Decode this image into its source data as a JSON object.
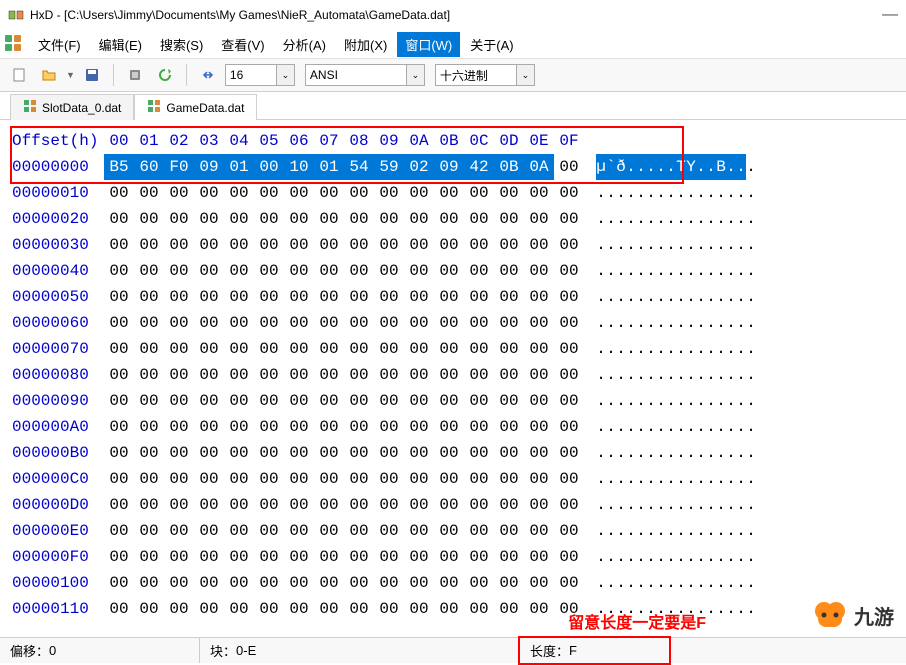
{
  "title": "HxD - [C:\\Users\\Jimmy\\Documents\\My Games\\NieR_Automata\\GameData.dat]",
  "menu": {
    "file": "文件(F)",
    "edit": "编辑(E)",
    "search": "搜索(S)",
    "view": "查看(V)",
    "analysis": "分析(A)",
    "extras": "附加(X)",
    "window": "窗口(W)",
    "about": "关于(A)"
  },
  "toolbar": {
    "bytes_per_row": "16",
    "encoding": "ANSI",
    "base": "十六进制"
  },
  "tabs": {
    "tab1": "SlotData_0.dat",
    "tab2": "GameData.dat"
  },
  "hex": {
    "offset_label": "Offset(h)",
    "cols": [
      "00",
      "01",
      "02",
      "03",
      "04",
      "05",
      "06",
      "07",
      "08",
      "09",
      "0A",
      "0B",
      "0C",
      "0D",
      "0E",
      "0F"
    ],
    "rows": [
      {
        "off": "00000000",
        "b": [
          "B5",
          "60",
          "F0",
          "09",
          "01",
          "00",
          "10",
          "01",
          "54",
          "59",
          "02",
          "09",
          "42",
          "0B",
          "0A",
          "00"
        ],
        "a": [
          "µ",
          "`",
          "ð",
          ".",
          ".",
          ".",
          ".",
          ".",
          "T",
          "Y",
          ".",
          ".",
          "B",
          ".",
          ".",
          "."
        ],
        "sel": 15
      },
      {
        "off": "00000010",
        "b": [
          "00",
          "00",
          "00",
          "00",
          "00",
          "00",
          "00",
          "00",
          "00",
          "00",
          "00",
          "00",
          "00",
          "00",
          "00",
          "00"
        ],
        "a": [
          ".",
          ".",
          ".",
          ".",
          ".",
          ".",
          ".",
          ".",
          ".",
          ".",
          ".",
          ".",
          ".",
          ".",
          ".",
          "."
        ]
      },
      {
        "off": "00000020",
        "b": [
          "00",
          "00",
          "00",
          "00",
          "00",
          "00",
          "00",
          "00",
          "00",
          "00",
          "00",
          "00",
          "00",
          "00",
          "00",
          "00"
        ],
        "a": [
          ".",
          ".",
          ".",
          ".",
          ".",
          ".",
          ".",
          ".",
          ".",
          ".",
          ".",
          ".",
          ".",
          ".",
          ".",
          "."
        ]
      },
      {
        "off": "00000030",
        "b": [
          "00",
          "00",
          "00",
          "00",
          "00",
          "00",
          "00",
          "00",
          "00",
          "00",
          "00",
          "00",
          "00",
          "00",
          "00",
          "00"
        ],
        "a": [
          ".",
          ".",
          ".",
          ".",
          ".",
          ".",
          ".",
          ".",
          ".",
          ".",
          ".",
          ".",
          ".",
          ".",
          ".",
          "."
        ]
      },
      {
        "off": "00000040",
        "b": [
          "00",
          "00",
          "00",
          "00",
          "00",
          "00",
          "00",
          "00",
          "00",
          "00",
          "00",
          "00",
          "00",
          "00",
          "00",
          "00"
        ],
        "a": [
          ".",
          ".",
          ".",
          ".",
          ".",
          ".",
          ".",
          ".",
          ".",
          ".",
          ".",
          ".",
          ".",
          ".",
          ".",
          "."
        ]
      },
      {
        "off": "00000050",
        "b": [
          "00",
          "00",
          "00",
          "00",
          "00",
          "00",
          "00",
          "00",
          "00",
          "00",
          "00",
          "00",
          "00",
          "00",
          "00",
          "00"
        ],
        "a": [
          ".",
          ".",
          ".",
          ".",
          ".",
          ".",
          ".",
          ".",
          ".",
          ".",
          ".",
          ".",
          ".",
          ".",
          ".",
          "."
        ]
      },
      {
        "off": "00000060",
        "b": [
          "00",
          "00",
          "00",
          "00",
          "00",
          "00",
          "00",
          "00",
          "00",
          "00",
          "00",
          "00",
          "00",
          "00",
          "00",
          "00"
        ],
        "a": [
          ".",
          ".",
          ".",
          ".",
          ".",
          ".",
          ".",
          ".",
          ".",
          ".",
          ".",
          ".",
          ".",
          ".",
          ".",
          "."
        ]
      },
      {
        "off": "00000070",
        "b": [
          "00",
          "00",
          "00",
          "00",
          "00",
          "00",
          "00",
          "00",
          "00",
          "00",
          "00",
          "00",
          "00",
          "00",
          "00",
          "00"
        ],
        "a": [
          ".",
          ".",
          ".",
          ".",
          ".",
          ".",
          ".",
          ".",
          ".",
          ".",
          ".",
          ".",
          ".",
          ".",
          ".",
          "."
        ]
      },
      {
        "off": "00000080",
        "b": [
          "00",
          "00",
          "00",
          "00",
          "00",
          "00",
          "00",
          "00",
          "00",
          "00",
          "00",
          "00",
          "00",
          "00",
          "00",
          "00"
        ],
        "a": [
          ".",
          ".",
          ".",
          ".",
          ".",
          ".",
          ".",
          ".",
          ".",
          ".",
          ".",
          ".",
          ".",
          ".",
          ".",
          "."
        ]
      },
      {
        "off": "00000090",
        "b": [
          "00",
          "00",
          "00",
          "00",
          "00",
          "00",
          "00",
          "00",
          "00",
          "00",
          "00",
          "00",
          "00",
          "00",
          "00",
          "00"
        ],
        "a": [
          ".",
          ".",
          ".",
          ".",
          ".",
          ".",
          ".",
          ".",
          ".",
          ".",
          ".",
          ".",
          ".",
          ".",
          ".",
          "."
        ]
      },
      {
        "off": "000000A0",
        "b": [
          "00",
          "00",
          "00",
          "00",
          "00",
          "00",
          "00",
          "00",
          "00",
          "00",
          "00",
          "00",
          "00",
          "00",
          "00",
          "00"
        ],
        "a": [
          ".",
          ".",
          ".",
          ".",
          ".",
          ".",
          ".",
          ".",
          ".",
          ".",
          ".",
          ".",
          ".",
          ".",
          ".",
          "."
        ]
      },
      {
        "off": "000000B0",
        "b": [
          "00",
          "00",
          "00",
          "00",
          "00",
          "00",
          "00",
          "00",
          "00",
          "00",
          "00",
          "00",
          "00",
          "00",
          "00",
          "00"
        ],
        "a": [
          ".",
          ".",
          ".",
          ".",
          ".",
          ".",
          ".",
          ".",
          ".",
          ".",
          ".",
          ".",
          ".",
          ".",
          ".",
          "."
        ]
      },
      {
        "off": "000000C0",
        "b": [
          "00",
          "00",
          "00",
          "00",
          "00",
          "00",
          "00",
          "00",
          "00",
          "00",
          "00",
          "00",
          "00",
          "00",
          "00",
          "00"
        ],
        "a": [
          ".",
          ".",
          ".",
          ".",
          ".",
          ".",
          ".",
          ".",
          ".",
          ".",
          ".",
          ".",
          ".",
          ".",
          ".",
          "."
        ]
      },
      {
        "off": "000000D0",
        "b": [
          "00",
          "00",
          "00",
          "00",
          "00",
          "00",
          "00",
          "00",
          "00",
          "00",
          "00",
          "00",
          "00",
          "00",
          "00",
          "00"
        ],
        "a": [
          ".",
          ".",
          ".",
          ".",
          ".",
          ".",
          ".",
          ".",
          ".",
          ".",
          ".",
          ".",
          ".",
          ".",
          ".",
          "."
        ]
      },
      {
        "off": "000000E0",
        "b": [
          "00",
          "00",
          "00",
          "00",
          "00",
          "00",
          "00",
          "00",
          "00",
          "00",
          "00",
          "00",
          "00",
          "00",
          "00",
          "00"
        ],
        "a": [
          ".",
          ".",
          ".",
          ".",
          ".",
          ".",
          ".",
          ".",
          ".",
          ".",
          ".",
          ".",
          ".",
          ".",
          ".",
          "."
        ]
      },
      {
        "off": "000000F0",
        "b": [
          "00",
          "00",
          "00",
          "00",
          "00",
          "00",
          "00",
          "00",
          "00",
          "00",
          "00",
          "00",
          "00",
          "00",
          "00",
          "00"
        ],
        "a": [
          ".",
          ".",
          ".",
          ".",
          ".",
          ".",
          ".",
          ".",
          ".",
          ".",
          ".",
          ".",
          ".",
          ".",
          ".",
          "."
        ]
      },
      {
        "off": "00000100",
        "b": [
          "00",
          "00",
          "00",
          "00",
          "00",
          "00",
          "00",
          "00",
          "00",
          "00",
          "00",
          "00",
          "00",
          "00",
          "00",
          "00"
        ],
        "a": [
          ".",
          ".",
          ".",
          ".",
          ".",
          ".",
          ".",
          ".",
          ".",
          ".",
          ".",
          ".",
          ".",
          ".",
          ".",
          "."
        ]
      },
      {
        "off": "00000110",
        "b": [
          "00",
          "00",
          "00",
          "00",
          "00",
          "00",
          "00",
          "00",
          "00",
          "00",
          "00",
          "00",
          "00",
          "00",
          "00",
          "00"
        ],
        "a": [
          ".",
          ".",
          ".",
          ".",
          ".",
          ".",
          ".",
          ".",
          ".",
          ".",
          ".",
          ".",
          ".",
          ".",
          ".",
          "."
        ]
      }
    ]
  },
  "status": {
    "offset_label": "偏移：",
    "offset_val": "0",
    "block_label": "块：",
    "block_val": "0-E",
    "length_label": "长度：",
    "length_val": "F"
  },
  "annotation": "留意长度一定要是F",
  "watermark": "九游"
}
